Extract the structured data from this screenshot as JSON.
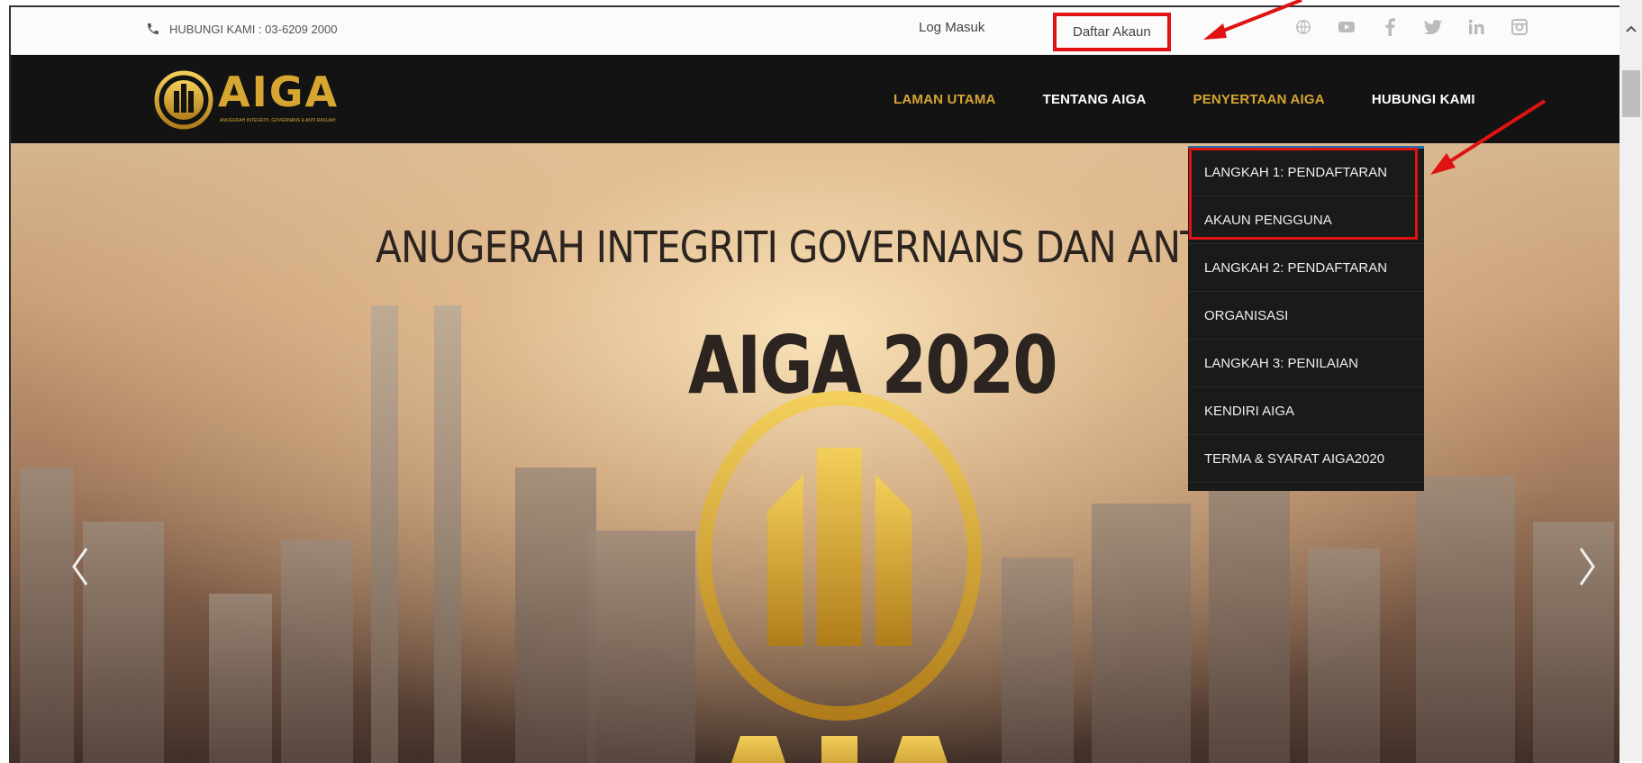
{
  "topbar": {
    "phone": "HUBUNGI KAMI : 03-6209 2000",
    "login": "Log Masuk",
    "signup": "Daftar Akaun",
    "social_icons": [
      "globe-icon",
      "youtube-icon",
      "facebook-icon",
      "twitter-icon",
      "linkedin-icon",
      "instagram-icon"
    ]
  },
  "navbar": {
    "logo_text": "AIGA",
    "logo_subtext": "ANUGERAH INTEGRITI, GOVERNANS & ANTI RASUAH",
    "items": [
      {
        "label": "LAMAN UTAMA",
        "active": true
      },
      {
        "label": "TENTANG AIGA",
        "active": false
      },
      {
        "label": "PENYERTAAN AIGA",
        "active": true
      },
      {
        "label": "HUBUNGI KAMI",
        "active": false
      }
    ]
  },
  "hero": {
    "title": "ANUGERAH INTEGRITI GOVERNANS DAN ANTI RA",
    "subtitle": "AIGA 2020"
  },
  "dropdown": {
    "items": [
      "LANGKAH 1: PENDAFTARAN",
      "AKAUN PENGGUNA",
      "LANGKAH 2: PENDAFTARAN",
      "ORGANISASI",
      "LANGKAH 3: PENILAIAN",
      "KENDIRI AIGA",
      "TERMA & SYARAT AIGA2020"
    ]
  },
  "colors": {
    "gold": "#d6a631",
    "navbar_bg": "#131313",
    "annotation_red": "#e01212"
  }
}
